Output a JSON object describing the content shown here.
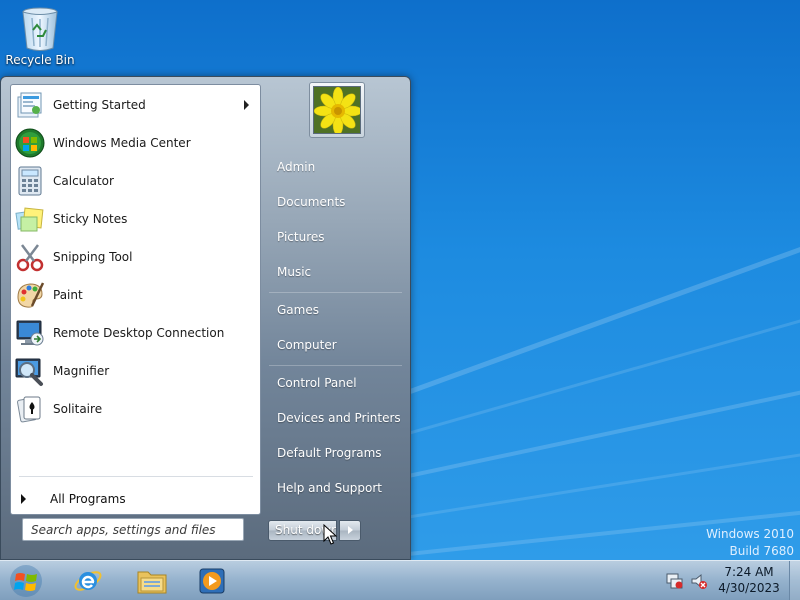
{
  "desktop": {
    "icons": [
      {
        "label": "Recycle Bin",
        "icon": "recycle-bin-icon"
      }
    ],
    "watermark": {
      "line1": "Windows 2010",
      "line2": "Build 7680"
    }
  },
  "start_menu": {
    "programs": [
      {
        "label": "Getting Started",
        "icon": "getting-started-icon",
        "has_submenu": true
      },
      {
        "label": "Windows Media Center",
        "icon": "windows-media-center-icon"
      },
      {
        "label": "Calculator",
        "icon": "calculator-icon"
      },
      {
        "label": "Sticky Notes",
        "icon": "sticky-notes-icon"
      },
      {
        "label": "Snipping Tool",
        "icon": "snipping-tool-icon"
      },
      {
        "label": "Paint",
        "icon": "paint-icon"
      },
      {
        "label": "Remote Desktop Connection",
        "icon": "remote-desktop-icon"
      },
      {
        "label": "Magnifier",
        "icon": "magnifier-icon"
      },
      {
        "label": "Solitaire",
        "icon": "solitaire-icon"
      }
    ],
    "all_programs_label": "All Programs",
    "search": {
      "placeholder": "Search apps, settings and files"
    },
    "user_picture": "flower-user-picture",
    "right_items": [
      {
        "label": "Admin"
      },
      {
        "label": "Documents"
      },
      {
        "label": "Pictures"
      },
      {
        "label": "Music"
      },
      {
        "label": "Games"
      },
      {
        "label": "Computer"
      },
      {
        "label": "Control Panel"
      },
      {
        "label": "Devices and Printers"
      },
      {
        "label": "Default Programs"
      },
      {
        "label": "Help and Support"
      }
    ],
    "shutdown_label": "Shut down"
  },
  "taskbar": {
    "pinned": [
      {
        "name": "start-orb",
        "icon": "windows-logo-icon"
      },
      {
        "name": "internet-explorer",
        "icon": "internet-explorer-icon"
      },
      {
        "name": "windows-explorer",
        "icon": "folder-icon"
      },
      {
        "name": "windows-media-player",
        "icon": "media-player-icon"
      }
    ],
    "tray": {
      "icons": [
        "network-icon",
        "volume-muted-icon"
      ],
      "time": "7:24 AM",
      "date": "4/30/2023"
    }
  },
  "colors": {
    "desktop_blue": "#1b86d8",
    "menu_frame": "#72859a",
    "taskbar": "#95b2cd"
  }
}
